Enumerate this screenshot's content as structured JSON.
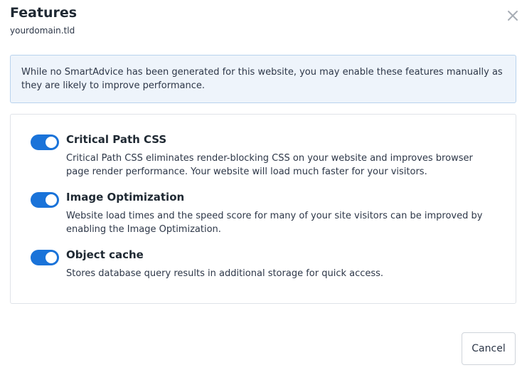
{
  "header": {
    "title": "Features",
    "subtitle": "yourdomain.tld",
    "close_icon": "close-icon"
  },
  "info_message": "While no SmartAdvice has been generated for this website, you may enable these features manually as they are likely to improve performance.",
  "features": [
    {
      "name": "Critical Path CSS",
      "description": "Critical Path CSS eliminates render-blocking CSS on your website and improves browser page render performance. Your website will load much faster for your visitors.",
      "enabled": true
    },
    {
      "name": "Image Optimization",
      "description": "Website load times and the speed score for many of your site visitors can be improved by enabling the Image Optimization.",
      "enabled": true
    },
    {
      "name": "Object cache",
      "description": "Stores database query results in additional storage for quick access.",
      "enabled": true
    }
  ],
  "footer": {
    "cancel_label": "Cancel"
  },
  "colors": {
    "toggle_on": "#1a73d9",
    "info_background": "#eef4fb",
    "info_border": "#b9d3ee"
  }
}
